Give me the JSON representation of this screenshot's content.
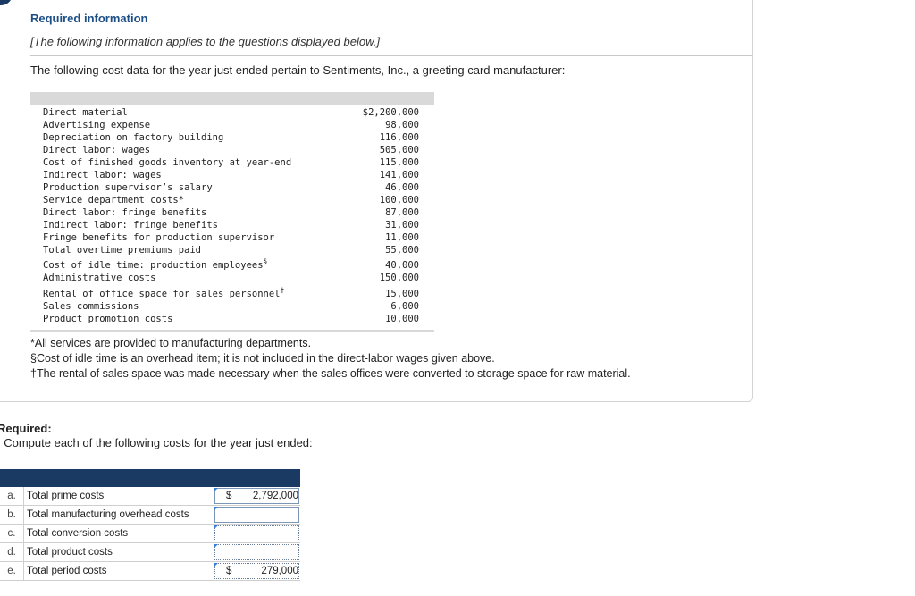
{
  "header": {
    "title": "Required information",
    "note": "[The following information applies to the questions displayed below.]",
    "intro": "The following cost data for the year just ended pertain to Sentiments, Inc., a greeting card manufacturer:"
  },
  "cost_data": [
    {
      "label": "Direct material",
      "value": "$2,200,000"
    },
    {
      "label": "Advertising expense",
      "value": "98,000"
    },
    {
      "label": "Depreciation on factory building",
      "value": "116,000"
    },
    {
      "label": "Direct labor: wages",
      "value": "505,000"
    },
    {
      "label": "Cost of finished goods inventory at year-end",
      "value": "115,000"
    },
    {
      "label": "Indirect labor: wages",
      "value": "141,000"
    },
    {
      "label": "Production supervisor’s salary",
      "value": "46,000"
    },
    {
      "label": "Service department costs*",
      "value": "100,000"
    },
    {
      "label": "Direct labor: fringe benefits",
      "value": "87,000"
    },
    {
      "label": "Indirect labor: fringe benefits",
      "value": "31,000"
    },
    {
      "label": "Fringe benefits for production supervisor",
      "value": "11,000"
    },
    {
      "label": "Total overtime premiums paid",
      "value": "55,000"
    },
    {
      "label": "Cost of idle time: production employees",
      "sup": "§",
      "value": "40,000"
    },
    {
      "label": "Administrative costs",
      "value": "150,000"
    },
    {
      "label": "Rental of office space for sales personnel",
      "sup": "†",
      "value": "15,000"
    },
    {
      "label": "Sales commissions",
      "value": "6,000"
    },
    {
      "label": "Product promotion costs",
      "value": "10,000"
    }
  ],
  "footnotes": [
    "*All services are provided to manufacturing departments.",
    "§Cost of idle time is an overhead item; it is not included in the direct-labor wages given above.",
    "†The rental of sales space was made necessary when the sales offices were converted to storage space for raw material."
  ],
  "required": {
    "label": "Required:",
    "question": ". Compute each of the following costs for the year just ended:"
  },
  "answers": [
    {
      "letter": "a.",
      "label": "Total prime costs",
      "dollar": "$",
      "amount": "2,792,000",
      "style": "solid"
    },
    {
      "letter": "b.",
      "label": "Total manufacturing overhead costs",
      "dollar": "",
      "amount": "",
      "style": "solid"
    },
    {
      "letter": "c.",
      "label": "Total conversion costs",
      "dollar": "",
      "amount": "",
      "style": "dotted"
    },
    {
      "letter": "d.",
      "label": "Total product costs",
      "dollar": "",
      "amount": "",
      "style": "dotted"
    },
    {
      "letter": "e.",
      "label": "Total period costs",
      "dollar": "$",
      "amount": "279,000",
      "style": "dotted"
    }
  ]
}
